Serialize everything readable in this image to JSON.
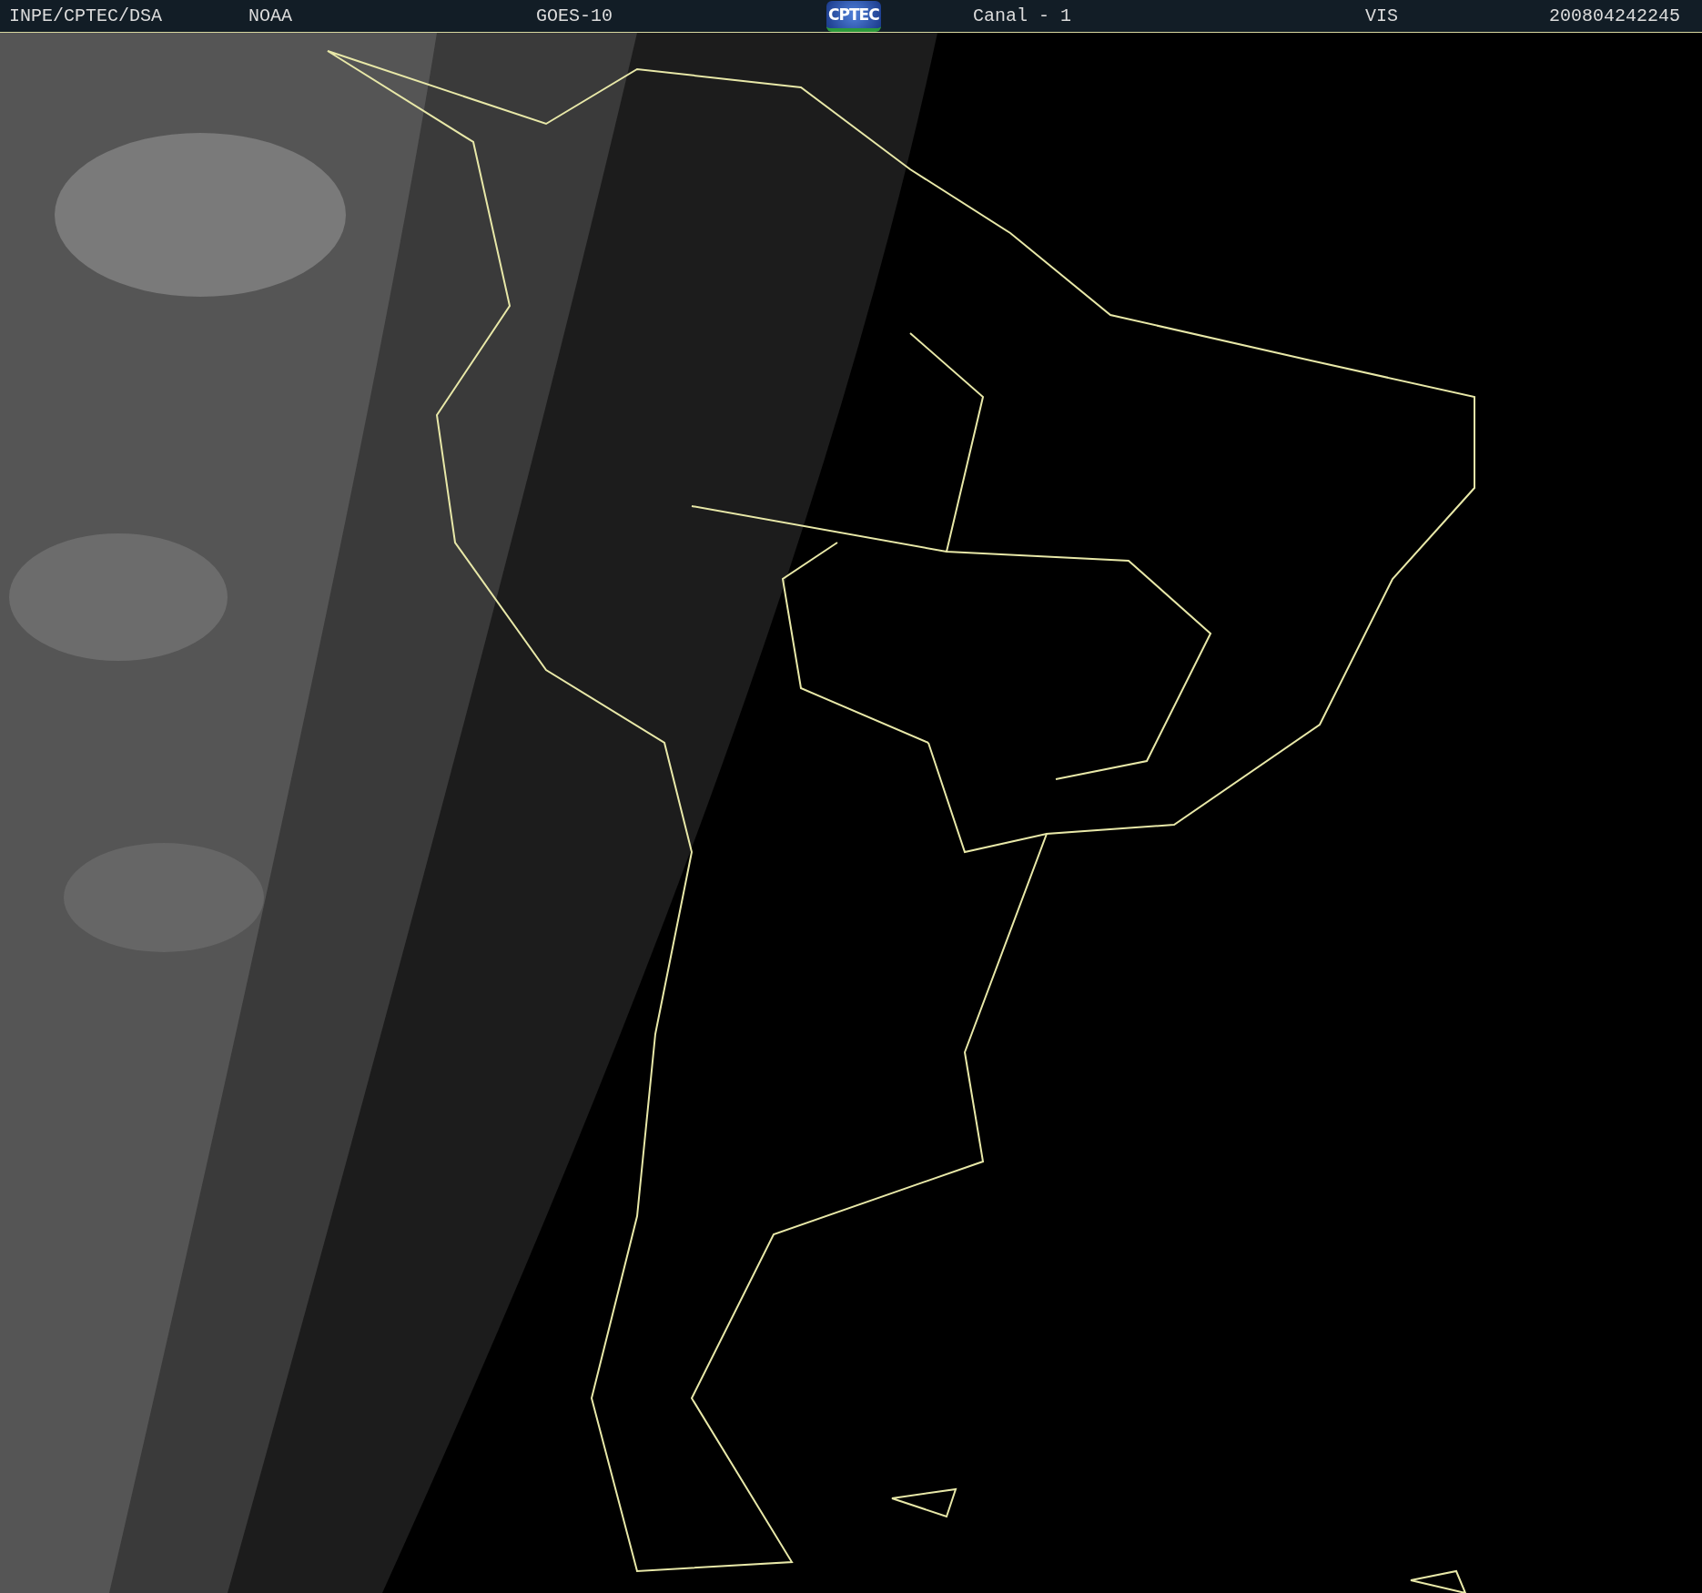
{
  "header": {
    "items": [
      {
        "kind": "text",
        "text": "INPE/CPTEC/DSA"
      },
      {
        "kind": "text",
        "text": "NOAA"
      },
      {
        "kind": "text",
        "text": "GOES-10"
      },
      {
        "kind": "logo",
        "text": "CPTEC"
      },
      {
        "kind": "text",
        "text": "Canal - 1"
      },
      {
        "kind": "text",
        "text": "VIS"
      },
      {
        "kind": "text",
        "text": "200804242245"
      }
    ]
  }
}
